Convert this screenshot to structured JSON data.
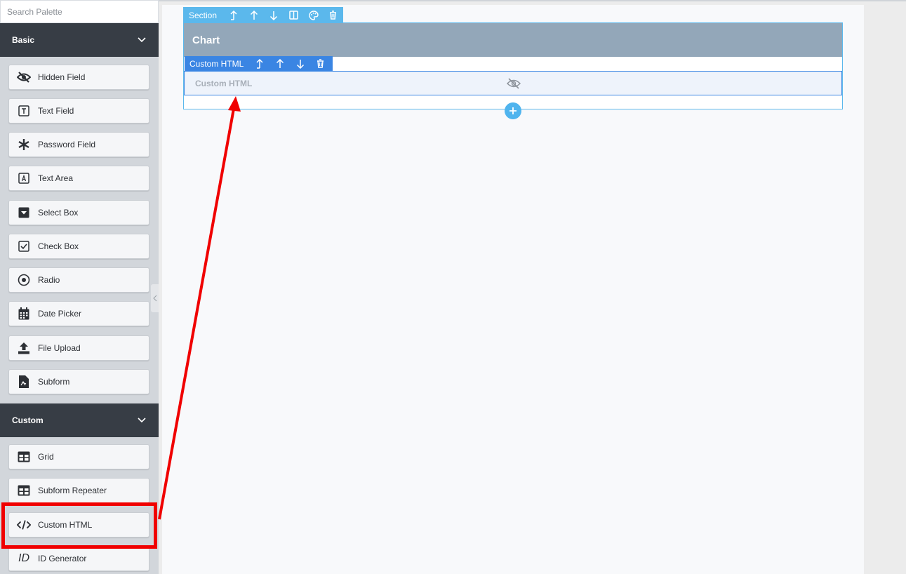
{
  "search": {
    "placeholder": "Search Palette",
    "value": ""
  },
  "groups": {
    "basic": {
      "title": "Basic",
      "items": [
        {
          "label": "Hidden Field",
          "icon": "eye-slash-icon"
        },
        {
          "label": "Text Field",
          "icon": "text-field-icon"
        },
        {
          "label": "Password Field",
          "icon": "asterisk-icon"
        },
        {
          "label": "Text Area",
          "icon": "text-area-icon"
        },
        {
          "label": "Select Box",
          "icon": "select-box-icon"
        },
        {
          "label": "Check Box",
          "icon": "checkbox-icon"
        },
        {
          "label": "Radio",
          "icon": "radio-icon"
        },
        {
          "label": "Date Picker",
          "icon": "calendar-icon"
        },
        {
          "label": "File Upload",
          "icon": "upload-icon"
        },
        {
          "label": "Subform",
          "icon": "subform-icon"
        }
      ]
    },
    "custom": {
      "title": "Custom",
      "items": [
        {
          "label": "Grid",
          "icon": "grid-icon"
        },
        {
          "label": "Subform Repeater",
          "icon": "grid-icon"
        },
        {
          "label": "Custom HTML",
          "icon": "code-icon"
        },
        {
          "label": "ID Generator",
          "icon": "id-icon"
        }
      ]
    }
  },
  "section_toolbar": {
    "label": "Section"
  },
  "section": {
    "title": "Chart"
  },
  "html_toolbar": {
    "label": "Custom HTML"
  },
  "html_field": {
    "label": "Custom HTML"
  },
  "id_icon_text": "ID",
  "colors": {
    "sidebar_header": "#373d45",
    "section_accent": "#5bb8ec",
    "field_accent": "#3a85e3",
    "section_header": "#93a7b9",
    "annotation": "#f00000"
  }
}
